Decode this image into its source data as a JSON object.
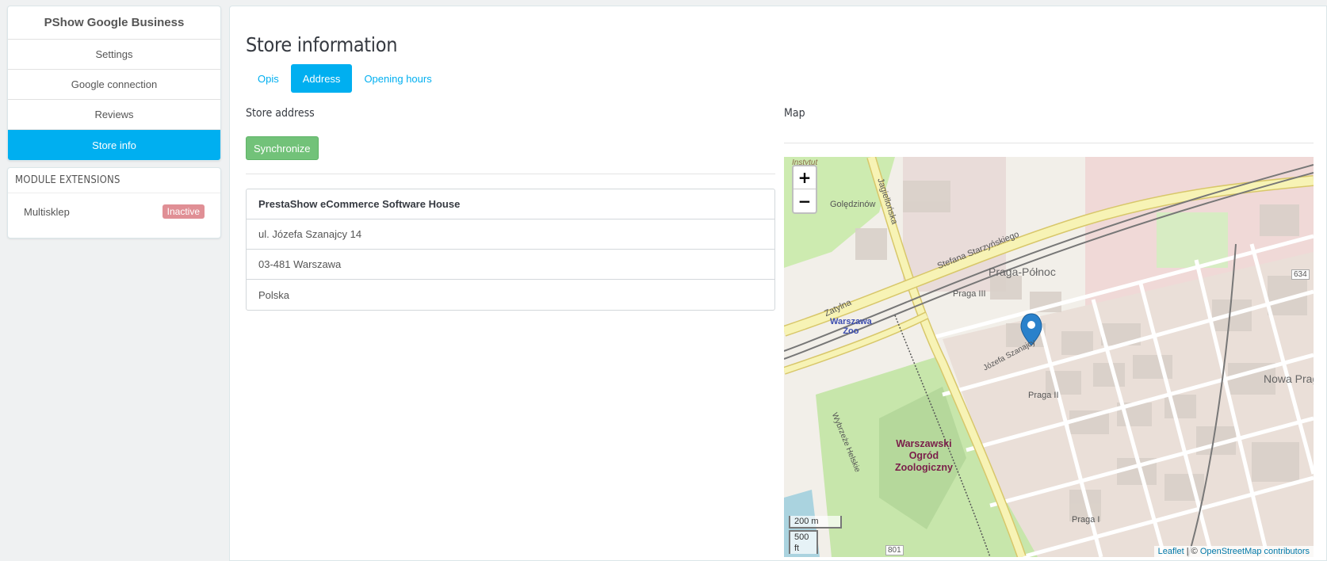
{
  "sidebar": {
    "title": "PShow Google Business",
    "items": [
      {
        "label": "Settings"
      },
      {
        "label": "Google connection"
      },
      {
        "label": "Reviews"
      },
      {
        "label": "Store info"
      }
    ],
    "extensions": {
      "header": "MODULE EXTENSIONS",
      "items": [
        {
          "name": "Multisklep",
          "status": "Inactive"
        }
      ]
    }
  },
  "main": {
    "title": "Store information",
    "tabs": [
      {
        "label": "Opis"
      },
      {
        "label": "Address"
      },
      {
        "label": "Opening hours"
      }
    ],
    "address_section": {
      "label": "Store address",
      "sync_button": "Synchronize",
      "lines": [
        "PrestaShow eCommerce Software House",
        "ul. Józefa Szanajcy 14",
        "03-481 Warszawa",
        "Polska"
      ]
    },
    "map_section": {
      "label": "Map",
      "zoom_in": "+",
      "zoom_out": "−",
      "scale_metric": "200 m",
      "scale_imperial": "500 ft",
      "attribution_leaflet": "Leaflet",
      "attribution_sep": " | © ",
      "attribution_osm": "OpenStreetMap contributors",
      "labels": {
        "praga_polnoc": "Praga-Północ",
        "praga_ii": "Praga II",
        "praga_iii": "Praga III",
        "praga_i": "Praga I",
        "nowa_praga": "Nowa Prag",
        "zoo_line1": "Warszawski",
        "zoo_line2": "Ogród",
        "zoo_line3": "Zoologiczny",
        "warszawa_zoo1": "Warszawa",
        "warszawa_zoo2": "Zoo",
        "goledzinow": "Golędzinów",
        "instytucja": "Instytut",
        "starzynskiego": "Stefana Starzyńskiego",
        "jagiellonska": "Jagiellońska",
        "zatylna": "Zatylna",
        "szanajcy": "Józefa Szanajcy",
        "wybrzeze": "Wybrzeże Helskie",
        "road_634": "634",
        "road_801": "801"
      }
    }
  },
  "colors": {
    "accent": "#00aff0",
    "success": "#72c279",
    "danger_badge": "#e08f95",
    "marker": "#2a81cb"
  }
}
